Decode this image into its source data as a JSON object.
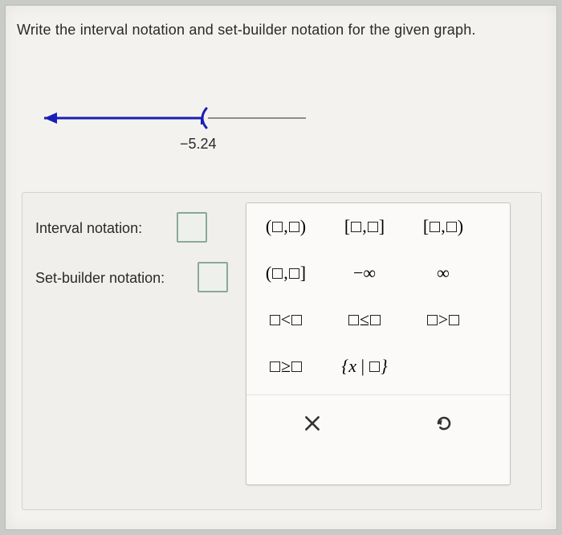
{
  "prompt": "Write the interval notation and set-builder notation for the given graph.",
  "numberline": {
    "tick_value": "−5.24"
  },
  "labels": {
    "interval": "Interval notation:",
    "setbuilder": "Set-builder notation:"
  },
  "palette": {
    "row1": {
      "open_open": "(□,□)",
      "closed_closed": "[□,□]",
      "closed_open": "[□,□)"
    },
    "row2": {
      "open_closed": "(□,□]",
      "neg_inf": "−∞",
      "pos_inf": "∞"
    },
    "row3": {
      "lt": "□<□",
      "le": "□≤□",
      "gt": "□>□"
    },
    "row4": {
      "ge": "□≥□",
      "set": "{x|□}"
    },
    "actions": {
      "clear": "×",
      "undo": "↺"
    }
  }
}
